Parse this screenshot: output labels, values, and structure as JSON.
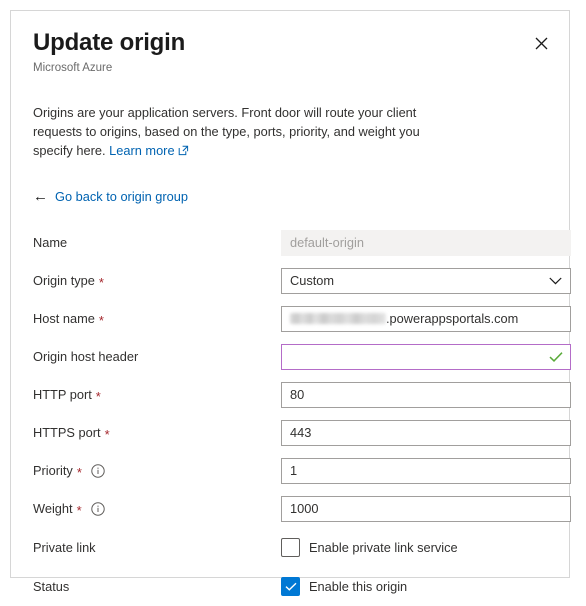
{
  "panel": {
    "title": "Update origin",
    "subtitle": "Microsoft Azure",
    "close_label": "✕",
    "close_icon": "close-icon"
  },
  "description": {
    "text_before_link": "Origins are your application servers. Front door will route your client requests to origins, based on the type, ports, priority, and weight you specify here.",
    "link_label": "Learn more",
    "link_icon": "external-link-icon"
  },
  "back": {
    "arrow": "←",
    "label": "Go back to origin group"
  },
  "form": {
    "required_marker": "*",
    "info_icon": "info-circle-icon",
    "chevron_icon": "chevron-down-icon",
    "valid_icon": "green-checkmark-icon",
    "fields": {
      "name": {
        "label": "Name",
        "value": "default-origin",
        "disabled": true
      },
      "origin_type": {
        "label": "Origin type",
        "required": true,
        "value": "Custom",
        "options": [
          "Custom"
        ]
      },
      "host_name": {
        "label": "Host name",
        "required": true,
        "value_redacted": true,
        "value_suffix": ".powerappsportals.com"
      },
      "origin_host_header": {
        "label": "Origin host header",
        "required": false,
        "value": "",
        "focused": true,
        "valid": true
      },
      "http_port": {
        "label": "HTTP port",
        "required": true,
        "value": "80"
      },
      "https_port": {
        "label": "HTTPS port",
        "required": true,
        "value": "443"
      },
      "priority": {
        "label": "Priority",
        "required": true,
        "has_info": true,
        "value": "1"
      },
      "weight": {
        "label": "Weight",
        "required": true,
        "has_info": true,
        "value": "1000"
      },
      "private_link": {
        "label": "Private link",
        "checkbox_label": "Enable private link service",
        "checked": false
      },
      "status": {
        "label": "Status",
        "checkbox_label": "Enable this origin",
        "checked": true
      }
    }
  },
  "colors": {
    "link": "#0063b1",
    "required": "#a4262c",
    "accent_checkbox": "#0078d4",
    "focus_border": "#b46cc8",
    "valid_check": "#5aaa3a"
  }
}
